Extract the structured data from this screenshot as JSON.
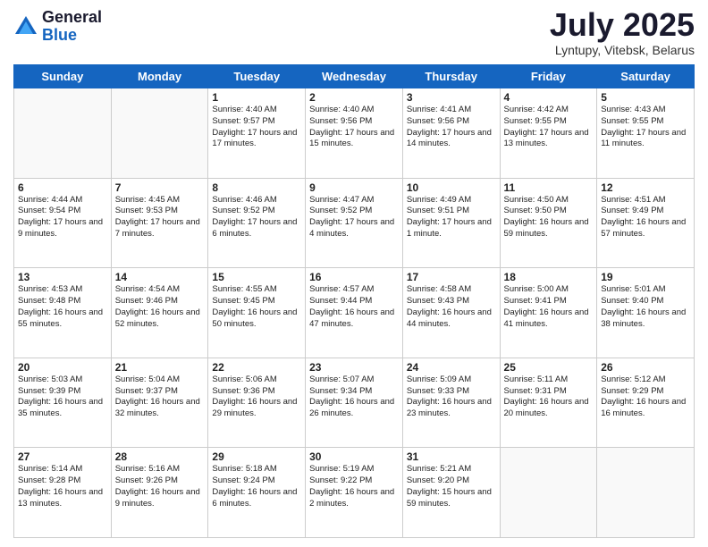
{
  "header": {
    "logo_general": "General",
    "logo_blue": "Blue",
    "month_year": "July 2025",
    "location": "Lyntupy, Vitebsk, Belarus"
  },
  "days_of_week": [
    "Sunday",
    "Monday",
    "Tuesday",
    "Wednesday",
    "Thursday",
    "Friday",
    "Saturday"
  ],
  "weeks": [
    [
      {
        "day": "",
        "info": ""
      },
      {
        "day": "",
        "info": ""
      },
      {
        "day": "1",
        "info": "Sunrise: 4:40 AM\nSunset: 9:57 PM\nDaylight: 17 hours and 17 minutes."
      },
      {
        "day": "2",
        "info": "Sunrise: 4:40 AM\nSunset: 9:56 PM\nDaylight: 17 hours and 15 minutes."
      },
      {
        "day": "3",
        "info": "Sunrise: 4:41 AM\nSunset: 9:56 PM\nDaylight: 17 hours and 14 minutes."
      },
      {
        "day": "4",
        "info": "Sunrise: 4:42 AM\nSunset: 9:55 PM\nDaylight: 17 hours and 13 minutes."
      },
      {
        "day": "5",
        "info": "Sunrise: 4:43 AM\nSunset: 9:55 PM\nDaylight: 17 hours and 11 minutes."
      }
    ],
    [
      {
        "day": "6",
        "info": "Sunrise: 4:44 AM\nSunset: 9:54 PM\nDaylight: 17 hours and 9 minutes."
      },
      {
        "day": "7",
        "info": "Sunrise: 4:45 AM\nSunset: 9:53 PM\nDaylight: 17 hours and 7 minutes."
      },
      {
        "day": "8",
        "info": "Sunrise: 4:46 AM\nSunset: 9:52 PM\nDaylight: 17 hours and 6 minutes."
      },
      {
        "day": "9",
        "info": "Sunrise: 4:47 AM\nSunset: 9:52 PM\nDaylight: 17 hours and 4 minutes."
      },
      {
        "day": "10",
        "info": "Sunrise: 4:49 AM\nSunset: 9:51 PM\nDaylight: 17 hours and 1 minute."
      },
      {
        "day": "11",
        "info": "Sunrise: 4:50 AM\nSunset: 9:50 PM\nDaylight: 16 hours and 59 minutes."
      },
      {
        "day": "12",
        "info": "Sunrise: 4:51 AM\nSunset: 9:49 PM\nDaylight: 16 hours and 57 minutes."
      }
    ],
    [
      {
        "day": "13",
        "info": "Sunrise: 4:53 AM\nSunset: 9:48 PM\nDaylight: 16 hours and 55 minutes."
      },
      {
        "day": "14",
        "info": "Sunrise: 4:54 AM\nSunset: 9:46 PM\nDaylight: 16 hours and 52 minutes."
      },
      {
        "day": "15",
        "info": "Sunrise: 4:55 AM\nSunset: 9:45 PM\nDaylight: 16 hours and 50 minutes."
      },
      {
        "day": "16",
        "info": "Sunrise: 4:57 AM\nSunset: 9:44 PM\nDaylight: 16 hours and 47 minutes."
      },
      {
        "day": "17",
        "info": "Sunrise: 4:58 AM\nSunset: 9:43 PM\nDaylight: 16 hours and 44 minutes."
      },
      {
        "day": "18",
        "info": "Sunrise: 5:00 AM\nSunset: 9:41 PM\nDaylight: 16 hours and 41 minutes."
      },
      {
        "day": "19",
        "info": "Sunrise: 5:01 AM\nSunset: 9:40 PM\nDaylight: 16 hours and 38 minutes."
      }
    ],
    [
      {
        "day": "20",
        "info": "Sunrise: 5:03 AM\nSunset: 9:39 PM\nDaylight: 16 hours and 35 minutes."
      },
      {
        "day": "21",
        "info": "Sunrise: 5:04 AM\nSunset: 9:37 PM\nDaylight: 16 hours and 32 minutes."
      },
      {
        "day": "22",
        "info": "Sunrise: 5:06 AM\nSunset: 9:36 PM\nDaylight: 16 hours and 29 minutes."
      },
      {
        "day": "23",
        "info": "Sunrise: 5:07 AM\nSunset: 9:34 PM\nDaylight: 16 hours and 26 minutes."
      },
      {
        "day": "24",
        "info": "Sunrise: 5:09 AM\nSunset: 9:33 PM\nDaylight: 16 hours and 23 minutes."
      },
      {
        "day": "25",
        "info": "Sunrise: 5:11 AM\nSunset: 9:31 PM\nDaylight: 16 hours and 20 minutes."
      },
      {
        "day": "26",
        "info": "Sunrise: 5:12 AM\nSunset: 9:29 PM\nDaylight: 16 hours and 16 minutes."
      }
    ],
    [
      {
        "day": "27",
        "info": "Sunrise: 5:14 AM\nSunset: 9:28 PM\nDaylight: 16 hours and 13 minutes."
      },
      {
        "day": "28",
        "info": "Sunrise: 5:16 AM\nSunset: 9:26 PM\nDaylight: 16 hours and 9 minutes."
      },
      {
        "day": "29",
        "info": "Sunrise: 5:18 AM\nSunset: 9:24 PM\nDaylight: 16 hours and 6 minutes."
      },
      {
        "day": "30",
        "info": "Sunrise: 5:19 AM\nSunset: 9:22 PM\nDaylight: 16 hours and 2 minutes."
      },
      {
        "day": "31",
        "info": "Sunrise: 5:21 AM\nSunset: 9:20 PM\nDaylight: 15 hours and 59 minutes."
      },
      {
        "day": "",
        "info": ""
      },
      {
        "day": "",
        "info": ""
      }
    ]
  ]
}
